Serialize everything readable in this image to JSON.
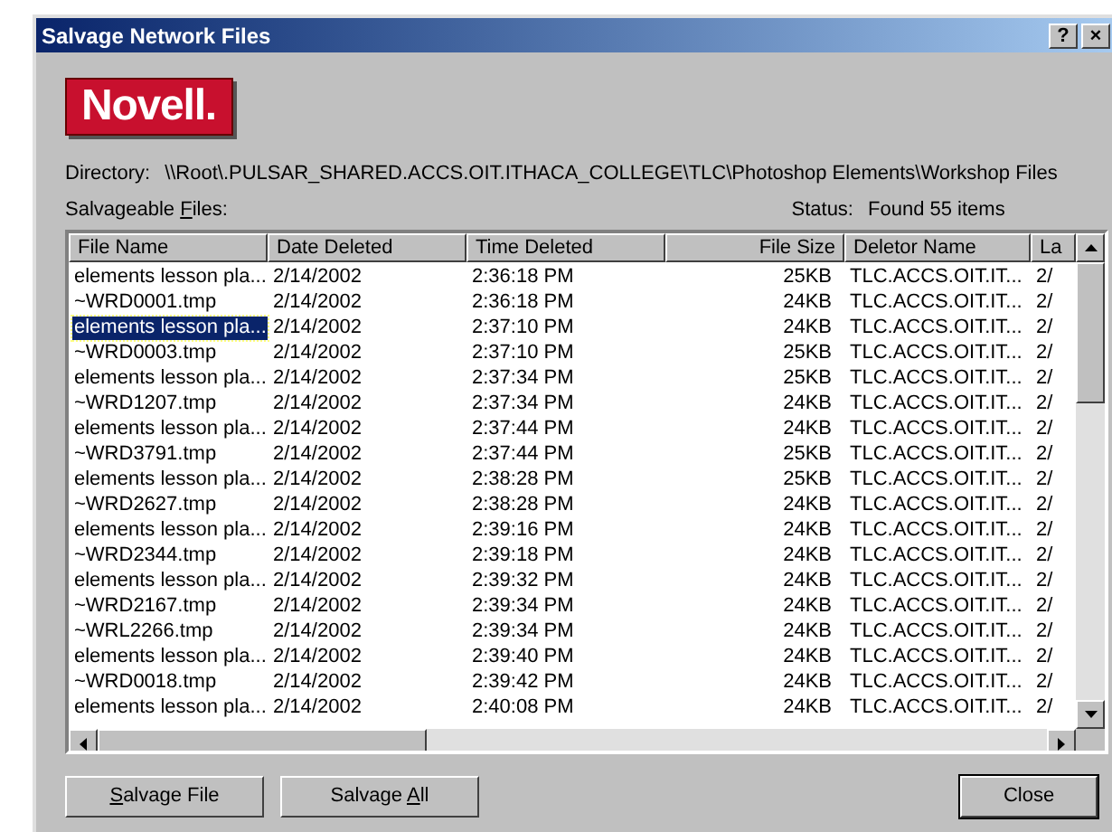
{
  "window": {
    "title": "Salvage Network Files",
    "title_buttons": [
      "?",
      "×"
    ]
  },
  "logo": {
    "text": "Novell."
  },
  "directory": {
    "label": "Directory:",
    "value": "\\\\Root\\.PULSAR_SHARED.ACCS.OIT.ITHACA_COLLEGE\\TLC\\Photoshop Elements\\Workshop Files"
  },
  "list_label": {
    "before": "Salvageable ",
    "mnemonic": "F",
    "after": "iles:"
  },
  "status": {
    "label": "Status:",
    "value": "Found 55 items"
  },
  "table": {
    "columns": [
      {
        "label": "File Name"
      },
      {
        "label": "Date Deleted"
      },
      {
        "label": "Time Deleted"
      },
      {
        "label": "File Size"
      },
      {
        "label": "Deletor Name"
      },
      {
        "label": "La"
      }
    ],
    "rows": [
      {
        "cells": [
          "elements lesson pla...",
          "2/14/2002",
          "2:36:18 PM",
          "25KB",
          "TLC.ACCS.OIT.IT...",
          "2/"
        ],
        "selected": false
      },
      {
        "cells": [
          "~WRD0001.tmp",
          "2/14/2002",
          "2:36:18 PM",
          "24KB",
          "TLC.ACCS.OIT.IT...",
          "2/"
        ],
        "selected": false
      },
      {
        "cells": [
          "elements lesson pla...",
          "2/14/2002",
          "2:37:10 PM",
          "24KB",
          "TLC.ACCS.OIT.IT...",
          "2/"
        ],
        "selected": true
      },
      {
        "cells": [
          "~WRD0003.tmp",
          "2/14/2002",
          "2:37:10 PM",
          "25KB",
          "TLC.ACCS.OIT.IT...",
          "2/"
        ],
        "selected": false
      },
      {
        "cells": [
          "elements lesson pla...",
          "2/14/2002",
          "2:37:34 PM",
          "25KB",
          "TLC.ACCS.OIT.IT...",
          "2/"
        ],
        "selected": false
      },
      {
        "cells": [
          "~WRD1207.tmp",
          "2/14/2002",
          "2:37:34 PM",
          "24KB",
          "TLC.ACCS.OIT.IT...",
          "2/"
        ],
        "selected": false
      },
      {
        "cells": [
          "elements lesson pla...",
          "2/14/2002",
          "2:37:44 PM",
          "24KB",
          "TLC.ACCS.OIT.IT...",
          "2/"
        ],
        "selected": false
      },
      {
        "cells": [
          "~WRD3791.tmp",
          "2/14/2002",
          "2:37:44 PM",
          "25KB",
          "TLC.ACCS.OIT.IT...",
          "2/"
        ],
        "selected": false
      },
      {
        "cells": [
          "elements lesson pla...",
          "2/14/2002",
          "2:38:28 PM",
          "25KB",
          "TLC.ACCS.OIT.IT...",
          "2/"
        ],
        "selected": false
      },
      {
        "cells": [
          "~WRD2627.tmp",
          "2/14/2002",
          "2:38:28 PM",
          "24KB",
          "TLC.ACCS.OIT.IT...",
          "2/"
        ],
        "selected": false
      },
      {
        "cells": [
          "elements lesson pla...",
          "2/14/2002",
          "2:39:16 PM",
          "24KB",
          "TLC.ACCS.OIT.IT...",
          "2/"
        ],
        "selected": false
      },
      {
        "cells": [
          "~WRD2344.tmp",
          "2/14/2002",
          "2:39:18 PM",
          "24KB",
          "TLC.ACCS.OIT.IT...",
          "2/"
        ],
        "selected": false
      },
      {
        "cells": [
          "elements lesson pla...",
          "2/14/2002",
          "2:39:32 PM",
          "24KB",
          "TLC.ACCS.OIT.IT...",
          "2/"
        ],
        "selected": false
      },
      {
        "cells": [
          "~WRD2167.tmp",
          "2/14/2002",
          "2:39:34 PM",
          "24KB",
          "TLC.ACCS.OIT.IT...",
          "2/"
        ],
        "selected": false
      },
      {
        "cells": [
          "~WRL2266.tmp",
          "2/14/2002",
          "2:39:34 PM",
          "24KB",
          "TLC.ACCS.OIT.IT...",
          "2/"
        ],
        "selected": false
      },
      {
        "cells": [
          "elements lesson pla...",
          "2/14/2002",
          "2:39:40 PM",
          "24KB",
          "TLC.ACCS.OIT.IT...",
          "2/"
        ],
        "selected": false
      },
      {
        "cells": [
          "~WRD0018.tmp",
          "2/14/2002",
          "2:39:42 PM",
          "24KB",
          "TLC.ACCS.OIT.IT...",
          "2/"
        ],
        "selected": false
      },
      {
        "cells": [
          "elements lesson pla...",
          "2/14/2002",
          "2:40:08 PM",
          "24KB",
          "TLC.ACCS.OIT.IT...",
          "2/"
        ],
        "selected": false
      }
    ]
  },
  "buttons": [
    {
      "mnemonic": "S",
      "after": "alvage File",
      "default": false
    },
    {
      "before": "Salvage ",
      "mnemonic": "A",
      "after": "ll",
      "default": false
    },
    {
      "before": "Close",
      "default": true
    }
  ]
}
